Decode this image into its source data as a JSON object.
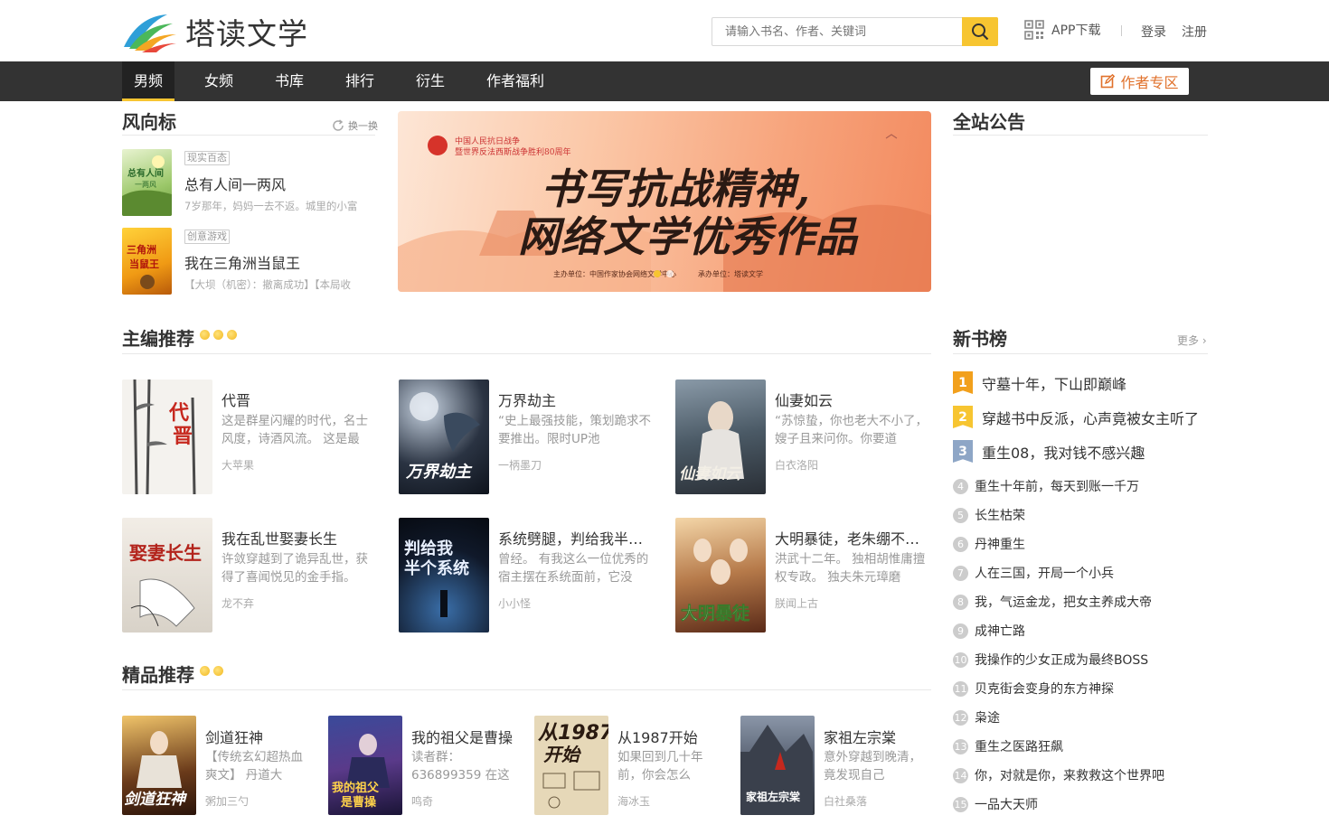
{
  "header": {
    "logo_text": "塔读文学",
    "search_placeholder": "请输入书名、作者、关键词",
    "app_download": "APP下载",
    "login": "登录",
    "register": "注册"
  },
  "nav": {
    "items": [
      "男频",
      "女频",
      "书库",
      "排行",
      "衍生",
      "作者福利"
    ],
    "author_zone": "作者专区"
  },
  "fengxiang": {
    "title": "风向标",
    "refresh": "换一换",
    "items": [
      {
        "tag": "现实百态",
        "name": "总有人间一两风",
        "desc": "7岁那年，妈妈一去不返。城里的小富"
      },
      {
        "tag": "创意游戏",
        "name": "我在三角洲当鼠王",
        "desc": "【大坝（机密）：撤离成功】【本局收"
      }
    ]
  },
  "banner": {
    "small_line1": "中国人民抗日战争",
    "small_line2": "暨世界反法西斯战争胜利80周年",
    "title_line1": "书写抗战精神,",
    "title_line2": "网络文学优秀作品",
    "footer": "主办单位：中国作家协会网络文学中心　　　承办单位：塔读文学"
  },
  "announcement": {
    "title": "全站公告"
  },
  "editor_picks": {
    "title": "主编推荐",
    "books": [
      {
        "name": "代晋",
        "desc": "这是群星闪耀的时代，名士风度，诗酒风流。 这是最",
        "author": "大苹果"
      },
      {
        "name": "万界劫主",
        "desc": "“史上最强技能，策划跪求不要推出。限时UP池",
        "author": "一柄墨刀"
      },
      {
        "name": "仙妻如云",
        "desc": "“苏惊蛰，你也老大不小了，嫂子且来问你。你要道",
        "author": "白衣洛阳"
      },
      {
        "name": "我在乱世娶妻长生",
        "desc": "许敛穿越到了诡异乱世，获得了喜闻悦见的金手指。",
        "author": "龙不弃"
      },
      {
        "name": "系统劈腿，判给我半个系统",
        "desc": "曾经。 有我这么一位优秀的宿主摆在系统面前，它没",
        "author": "小小怪"
      },
      {
        "name": "大明暴徒，老朱绷不住了",
        "desc": "洪武十二年。 独相胡惟庸擅权专政。 独夫朱元璋磨",
        "author": "朕闻上古"
      }
    ]
  },
  "quality_picks": {
    "title": "精品推荐",
    "books": [
      {
        "name": "剑道狂神",
        "desc": "【传统玄幻超热血爽文】 丹道大",
        "author": "粥加三勺"
      },
      {
        "name": "我的祖父是曹操",
        "desc": "读者群：636899359 在这",
        "author": "鸣奇"
      },
      {
        "name": "从1987开始",
        "desc": "如果回到几十年前，你会怎么",
        "author": "海冰玉"
      },
      {
        "name": "家祖左宗棠",
        "desc": "意外穿越到晚清，竟发现自己",
        "author": "白社桑落"
      }
    ]
  },
  "new_books": {
    "title": "新书榜",
    "more": "更多",
    "items": [
      {
        "rank": "1",
        "name": "守墓十年，下山即巅峰"
      },
      {
        "rank": "2",
        "name": "穿越书中反派，心声竟被女主听了"
      },
      {
        "rank": "3",
        "name": "重生08，我对钱不感兴趣"
      },
      {
        "rank": "4",
        "name": "重生十年前，每天到账一千万"
      },
      {
        "rank": "5",
        "name": "长生枯荣"
      },
      {
        "rank": "6",
        "name": "丹神重生"
      },
      {
        "rank": "7",
        "name": "人在三国，开局一个小兵"
      },
      {
        "rank": "8",
        "name": "我，气运金龙，把女主养成大帝"
      },
      {
        "rank": "9",
        "name": "成神亡路"
      },
      {
        "rank": "10",
        "name": "我操作的少女正成为最终BOSS"
      },
      {
        "rank": "11",
        "name": "贝克街会变身的东方神探"
      },
      {
        "rank": "12",
        "name": "枭途"
      },
      {
        "rank": "13",
        "name": "重生之医路狂飙"
      },
      {
        "rank": "14",
        "name": "你，对就是你，来救救这个世界吧"
      },
      {
        "rank": "15",
        "name": "一品大天师"
      }
    ]
  },
  "colors": {
    "accent": "#f7c531",
    "nav_bg": "#333333",
    "author_btn": "#e0712b"
  }
}
